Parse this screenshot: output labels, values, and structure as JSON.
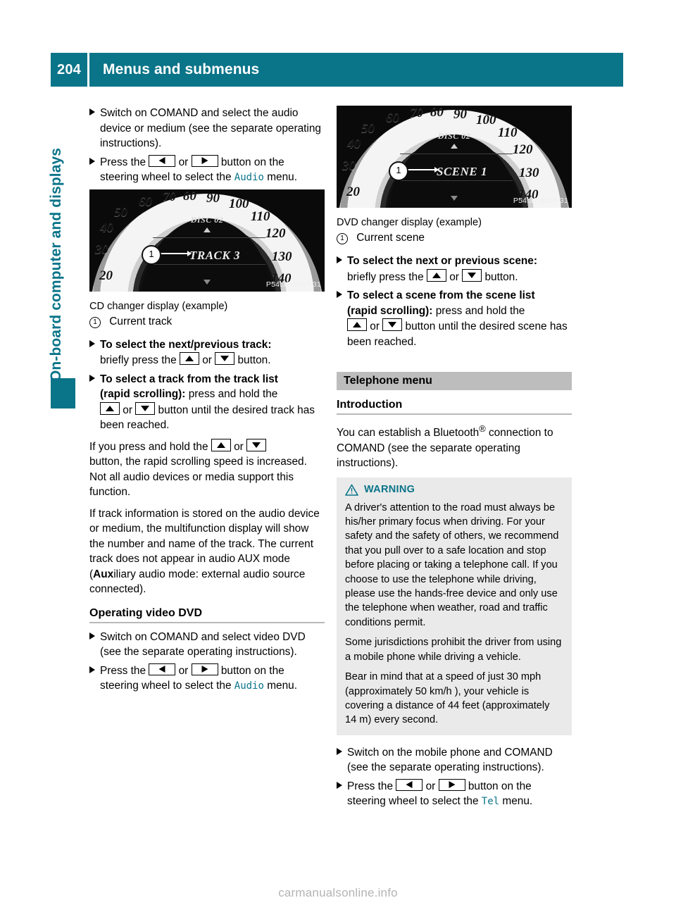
{
  "header": {
    "page_number": "204",
    "title": "Menus and submenus",
    "accent_color": "#0a7489"
  },
  "side_tab": {
    "label": "On-board computer and displays"
  },
  "left_column": {
    "step_switch_comand": "Switch on COMAND and select the audio device or medium (see the separate operating instructions).",
    "step_press_prefix": "Press the",
    "or_word": "or",
    "step_press_suffix": "button on the steering wheel to select the",
    "menu_name_audio": "Audio",
    "menu_word": "menu.",
    "figure": {
      "disc_label": "DISC 02",
      "track_label": "TRACK 3",
      "callout_number": "1",
      "image_code": "P54.32-8847-31",
      "speed_ticks": [
        "20",
        "30",
        "40",
        "50",
        "60",
        "70",
        "80",
        "90",
        "100",
        "110",
        "120",
        "130",
        "140"
      ]
    },
    "caption": "CD changer display (example)",
    "legend_number": "1",
    "legend_text": "Current track",
    "bold_next_prev_track": "To select the next/previous track:",
    "briefly_press_prefix": "briefly press the",
    "button_word": "button.",
    "bold_track_list_1": "To select a track from the track list",
    "bold_track_list_2": "(rapid scrolling):",
    "track_list_rest_1": "press and hold the",
    "track_list_rest_2": "button until the desired track has been reached.",
    "para_hold_1": "If you press and hold the",
    "para_hold_2": "button, the rapid scrolling speed is increased. Not all audio devices or media support this function.",
    "para_track_info_a": "If track information is stored on the audio device or medium, the multifunction display will show the number and name of the track. The current track does not appear in audio AUX mode (",
    "para_track_info_bold": "Aux",
    "para_track_info_b": "iliary audio mode: external audio source connected).",
    "subheading_video_dvd": "Operating video DVD",
    "step_switch_video_dvd": "Switch on COMAND and select video DVD (see the separate operating instructions)."
  },
  "right_column": {
    "figure": {
      "disc_label": "DISC 02",
      "scene_label": "SCENE 1",
      "callout_number": "1",
      "image_code": "P54.32-8848-31",
      "speed_ticks": [
        "20",
        "30",
        "40",
        "50",
        "60",
        "70",
        "80",
        "90",
        "100",
        "110",
        "120",
        "130",
        "140"
      ]
    },
    "caption": "DVD changer display (example)",
    "legend_number": "1",
    "legend_text": "Current scene",
    "bold_next_prev_scene": "To select the next or previous scene:",
    "briefly_press_prefix": "briefly press the",
    "or_word": "or",
    "button_word": "button.",
    "bold_scene_list_1": "To select a scene from the scene list",
    "bold_scene_list_2": "(rapid scrolling):",
    "scene_list_rest_1": "press and hold the",
    "scene_list_rest_2": "button until the desired scene has been reached.",
    "section_banner": "Telephone menu",
    "subheading_introduction": "Introduction",
    "intro_a": "You can establish a Bluetooth",
    "intro_reg": "®",
    "intro_b": " connection to COMAND (see the separate operating instructions).",
    "warning": {
      "icon": "warning-triangle-icon",
      "title": "WARNING",
      "title_color": "#0a7489",
      "paragraphs": [
        "A driver's attention to the road must always be his/her primary focus when driving. For your safety and the safety of others, we recommend that you pull over to a safe location and stop before placing or taking a telephone call. If you choose to use the telephone while driving, please use the hands-free device and only use the telephone when weather, road and traffic conditions permit.",
        "Some jurisdictions prohibit the driver from using a mobile phone while driving a vehicle.",
        "Bear in mind that at a speed of just 30 mph (approximately 50 km/h ), your vehicle is covering a distance of 44 feet (approximately 14 m) every second."
      ]
    },
    "step_switch_mobile": "Switch on the mobile phone and COMAND (see the separate operating instructions).",
    "step_press_prefix": "Press the",
    "step_press_suffix": "button on the steering wheel to select the",
    "menu_name_tel": "Tel",
    "menu_word": "menu."
  },
  "footer": {
    "watermark": "carmanualsonline.info"
  }
}
